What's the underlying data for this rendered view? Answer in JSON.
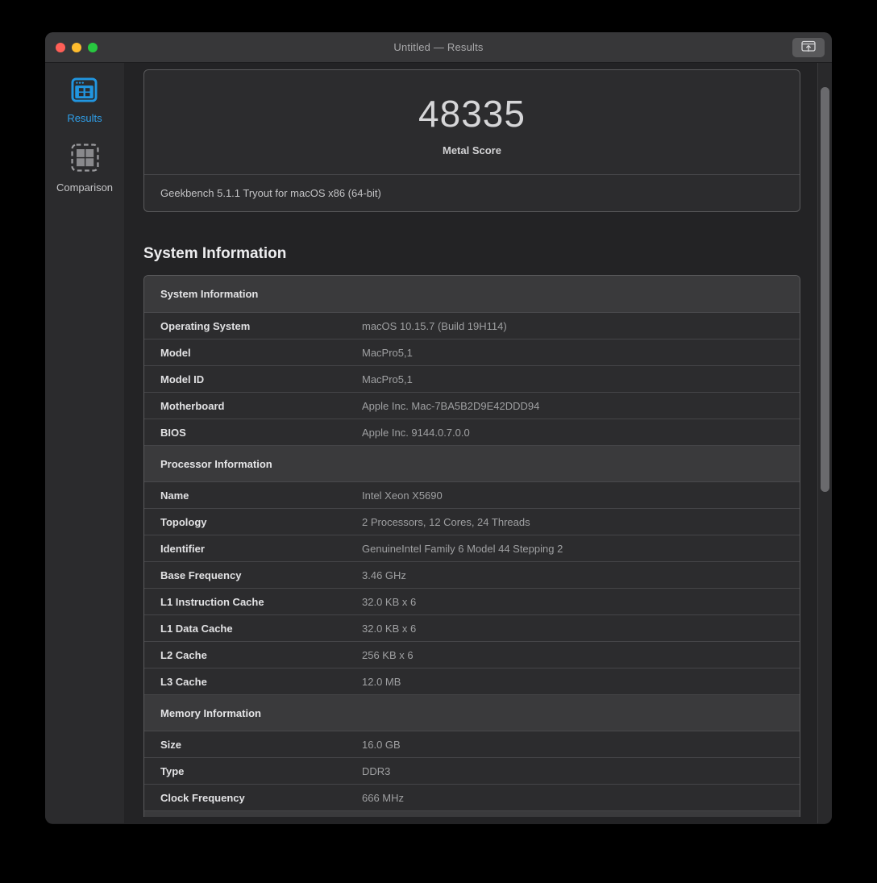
{
  "titlebar": {
    "title": "Untitled — Results",
    "traffic_lights": [
      "close",
      "minimize",
      "zoom"
    ],
    "share_button_icon": "window-upload-icon"
  },
  "sidebar": {
    "items": [
      {
        "label": "Results",
        "icon": "results-window-grid-icon",
        "active": true
      },
      {
        "label": "Comparison",
        "icon": "comparison-grid-icon",
        "active": false
      }
    ]
  },
  "result_card": {
    "score": "48335",
    "score_label": "Metal Score",
    "benchmark_version": "Geekbench 5.1.1 Tryout for macOS x86 (64-bit)"
  },
  "page_heading": "System Information",
  "table": {
    "sections": [
      {
        "header": "System Information",
        "rows": [
          {
            "label": "Operating System",
            "value": "macOS 10.15.7 (Build 19H114)"
          },
          {
            "label": "Model",
            "value": "MacPro5,1"
          },
          {
            "label": "Model ID",
            "value": "MacPro5,1"
          },
          {
            "label": "Motherboard",
            "value": "Apple Inc. Mac-7BA5B2D9E42DDD94"
          },
          {
            "label": "BIOS",
            "value": "Apple Inc. 9144.0.7.0.0"
          }
        ]
      },
      {
        "header": "Processor Information",
        "rows": [
          {
            "label": "Name",
            "value": "Intel Xeon X5690"
          },
          {
            "label": "Topology",
            "value": "2 Processors, 12 Cores, 24 Threads"
          },
          {
            "label": "Identifier",
            "value": "GenuineIntel Family 6 Model 44 Stepping 2"
          },
          {
            "label": "Base Frequency",
            "value": "3.46 GHz"
          },
          {
            "label": "L1 Instruction Cache",
            "value": "32.0 KB x 6"
          },
          {
            "label": "L1 Data Cache",
            "value": "32.0 KB x 6"
          },
          {
            "label": "L2 Cache",
            "value": "256 KB x 6"
          },
          {
            "label": "L3 Cache",
            "value": "12.0 MB"
          }
        ]
      },
      {
        "header": "Memory Information",
        "rows": [
          {
            "label": "Size",
            "value": "16.0 GB"
          },
          {
            "label": "Type",
            "value": "DDR3"
          },
          {
            "label": "Clock Frequency",
            "value": "666 MHz"
          }
        ]
      }
    ],
    "next_section_partially_visible": true
  },
  "colors": {
    "accent_blue": "#2196e0",
    "traffic_red": "#ff5f57",
    "traffic_yellow": "#febc2e",
    "traffic_green": "#28c840",
    "card_background": "#2c2c2e",
    "section_header_background": "#3a3a3c"
  }
}
